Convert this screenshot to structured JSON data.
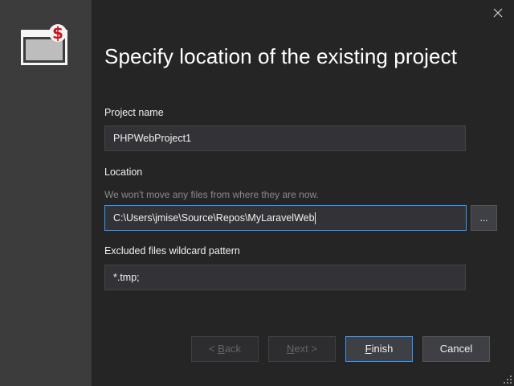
{
  "dialog": {
    "title": "Specify location of the existing project",
    "close_icon": "close-icon",
    "app_icon": "php-project-icon"
  },
  "fields": {
    "project_name": {
      "label": "Project name",
      "value": "PHPWebProject1"
    },
    "location": {
      "label": "Location",
      "hint": "We won't move any files from where they are now.",
      "value": "C:\\Users\\jmise\\Source\\Repos\\MyLaravelWeb",
      "browse_label": "..."
    },
    "excluded": {
      "label": "Excluded files wildcard pattern",
      "value": "*.tmp;"
    }
  },
  "buttons": {
    "back": {
      "prefix": "< ",
      "accel": "B",
      "rest": "ack"
    },
    "next": {
      "prefix": "",
      "accel": "N",
      "rest": "ext >"
    },
    "finish": {
      "prefix": "",
      "accel": "F",
      "rest": "inish"
    },
    "cancel": "Cancel"
  },
  "colors": {
    "background": "#252526",
    "left_pane": "#3c3c3d",
    "field_background": "#333337",
    "focus_border": "#3399ff",
    "icon_badge": "#c5161d"
  }
}
